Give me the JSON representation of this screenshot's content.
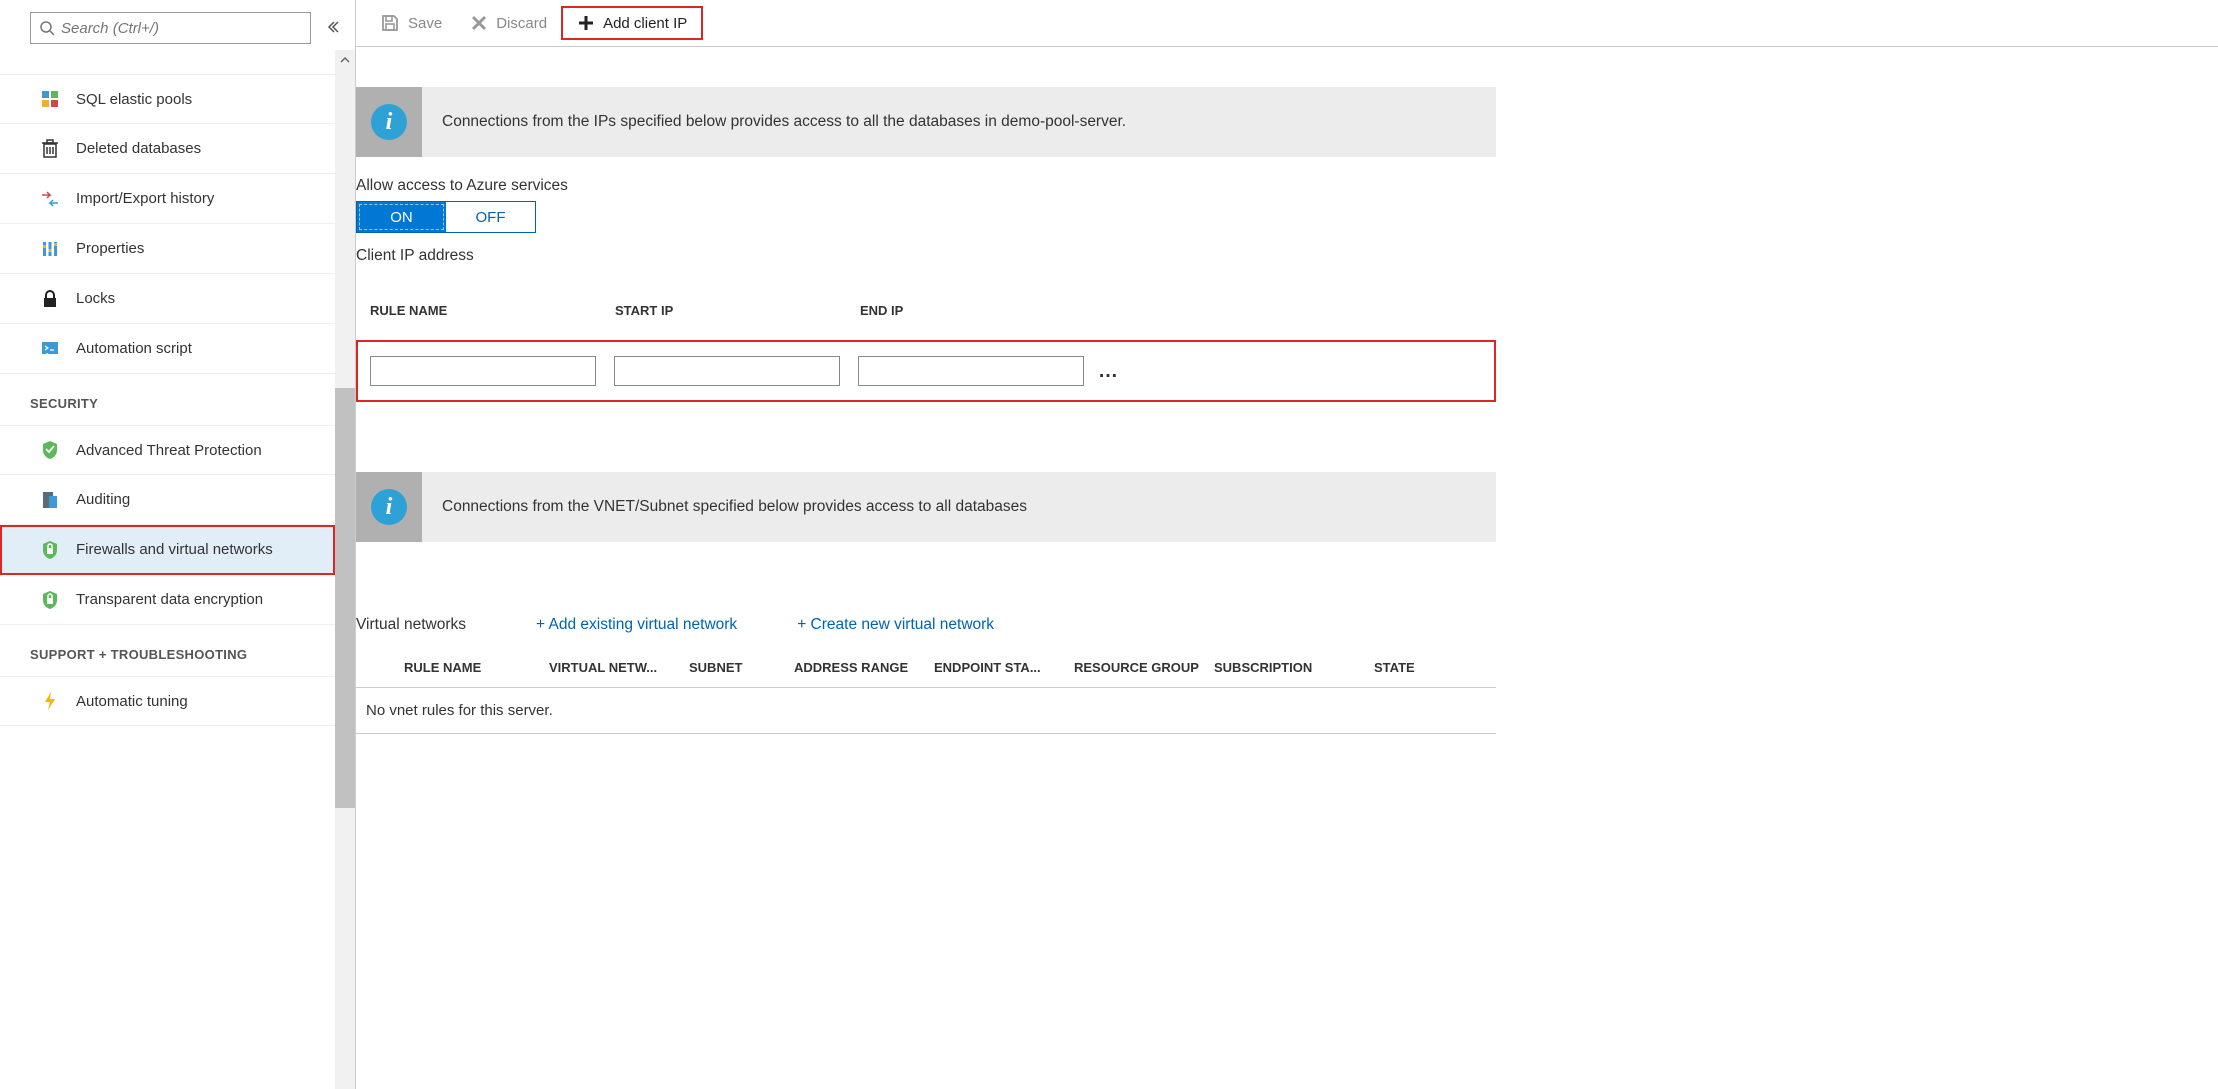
{
  "sidebar": {
    "search_placeholder": "Search (Ctrl+/)",
    "items": [
      {
        "label": "SQL elastic pools"
      },
      {
        "label": "Deleted databases"
      },
      {
        "label": "Import/Export history"
      },
      {
        "label": "Properties"
      },
      {
        "label": "Locks"
      },
      {
        "label": "Automation script"
      }
    ],
    "section_security": "SECURITY",
    "security_items": [
      {
        "label": "Advanced Threat Protection"
      },
      {
        "label": "Auditing"
      },
      {
        "label": "Firewalls and virtual networks"
      },
      {
        "label": "Transparent data encryption"
      }
    ],
    "section_support": "SUPPORT + TROUBLESHOOTING",
    "support_items": [
      {
        "label": "Automatic tuning"
      }
    ]
  },
  "toolbar": {
    "save": "Save",
    "discard": "Discard",
    "add_client_ip": "Add client IP"
  },
  "main": {
    "info1": "Connections from the IPs specified below provides access to all the databases in demo-pool-server.",
    "allow_label": "Allow access to Azure services",
    "toggle_on": "ON",
    "toggle_off": "OFF",
    "client_ip_label": "Client IP address",
    "fw_headers": {
      "rule": "RULE NAME",
      "start": "START IP",
      "end": "END IP"
    },
    "info2": "Connections from the VNET/Subnet specified below provides access to all databases",
    "vnet_title": "Virtual networks",
    "vnet_add_existing": "+ Add existing virtual network",
    "vnet_create_new": "+ Create new virtual network",
    "vnet_headers": {
      "rule": "RULE NAME",
      "vnet": "VIRTUAL NETW...",
      "subnet": "SUBNET",
      "addr": "ADDRESS RANGE",
      "endpoint": "ENDPOINT STA...",
      "rg": "RESOURCE GROUP",
      "sub": "SUBSCRIPTION",
      "state": "STATE"
    },
    "vnet_empty": "No vnet rules for this server."
  }
}
